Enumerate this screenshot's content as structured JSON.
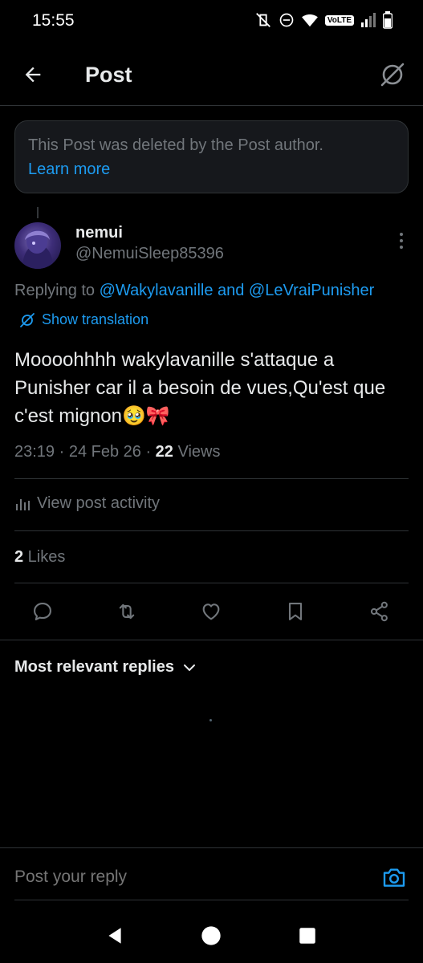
{
  "status_bar": {
    "time": "15:55",
    "network_badge": "VoLTE"
  },
  "header": {
    "title": "Post",
    "back_icon": "arrow-left-icon",
    "right_icon": "grok-icon"
  },
  "deleted_notice": {
    "text": "This Post was deleted by the Post author.",
    "link": "Learn more"
  },
  "post": {
    "author_name": "nemui",
    "author_handle": "@NemuiSleep85396",
    "replying_prefix": "Replying to ",
    "replying_mentions": "@Wakylavanille and @LeVraiPunisher",
    "translation_label": "Show translation",
    "text": "Moooohhhh wakylavanille s'attaque a Punisher car il a besoin de vues,Qu'est que c'est mignon🥹🎀",
    "timestamp": "23:19 · 24 Feb 26 · ",
    "views_count": "22",
    "views_label": " Views",
    "activity_label": "View post activity",
    "likes_count": "2",
    "likes_label": " Likes"
  },
  "actions": [
    "reply-icon",
    "repost-icon",
    "like-icon",
    "bookmark-icon",
    "share-icon"
  ],
  "replies": {
    "sort_label": "Most relevant replies"
  },
  "composer": {
    "placeholder": "Post your reply"
  },
  "colors": {
    "accent": "#1d9bf0",
    "background": "#000000",
    "muted": "#71767b",
    "border": "#2f3336"
  }
}
